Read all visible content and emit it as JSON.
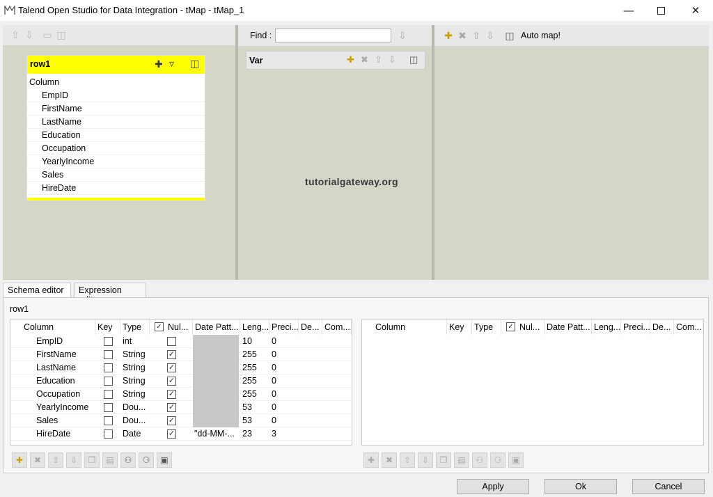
{
  "window": {
    "title": "Talend Open Studio for Data Integration - tMap - tMap_1"
  },
  "find": {
    "label": "Find :",
    "value": ""
  },
  "var_panel": {
    "title": "Var"
  },
  "output_toolbar": {
    "auto_map_label": "Auto map!"
  },
  "input_table": {
    "name": "row1",
    "column_header": "Column",
    "columns": [
      "EmpID",
      "FirstName",
      "LastName",
      "Education",
      "Occupation",
      "YearlyIncome",
      "Sales",
      "HireDate"
    ]
  },
  "watermark": "tutorialgateway.org",
  "tabs": [
    {
      "label": "Schema editor"
    },
    {
      "label": "Expression editor"
    }
  ],
  "schema_editor": {
    "table_name": "row1",
    "headers": [
      "Column",
      "Key",
      "Type",
      "Nul...",
      "Date Patt...",
      "Leng...",
      "Preci...",
      "De...",
      "Com..."
    ],
    "rows": [
      {
        "column": "EmpID",
        "key": false,
        "type": "int",
        "nullable": false,
        "pattern": "",
        "length": "10",
        "precision": "0"
      },
      {
        "column": "FirstName",
        "key": false,
        "type": "String",
        "nullable": true,
        "pattern": "",
        "length": "255",
        "precision": "0"
      },
      {
        "column": "LastName",
        "key": false,
        "type": "String",
        "nullable": true,
        "pattern": "",
        "length": "255",
        "precision": "0"
      },
      {
        "column": "Education",
        "key": false,
        "type": "String",
        "nullable": true,
        "pattern": "",
        "length": "255",
        "precision": "0"
      },
      {
        "column": "Occupation",
        "key": false,
        "type": "String",
        "nullable": true,
        "pattern": "",
        "length": "255",
        "precision": "0"
      },
      {
        "column": "YearlyIncome",
        "key": false,
        "type": "Dou...",
        "nullable": true,
        "pattern": "",
        "length": "53",
        "precision": "0"
      },
      {
        "column": "Sales",
        "key": false,
        "type": "Dou...",
        "nullable": true,
        "pattern": "",
        "length": "53",
        "precision": "0"
      },
      {
        "column": "HireDate",
        "key": false,
        "type": "Date",
        "nullable": true,
        "pattern": "\"dd-MM-...",
        "length": "23",
        "precision": "3"
      }
    ],
    "output_headers": [
      "Column",
      "Key",
      "Type",
      "Nul...",
      "Date Patt...",
      "Leng...",
      "Preci...",
      "De...",
      "Com..."
    ]
  },
  "buttons": {
    "apply": "Apply",
    "ok": "Ok",
    "cancel": "Cancel"
  },
  "colors": {
    "table_header": "#ffff00",
    "panel_bg": "#d5d5c8"
  }
}
